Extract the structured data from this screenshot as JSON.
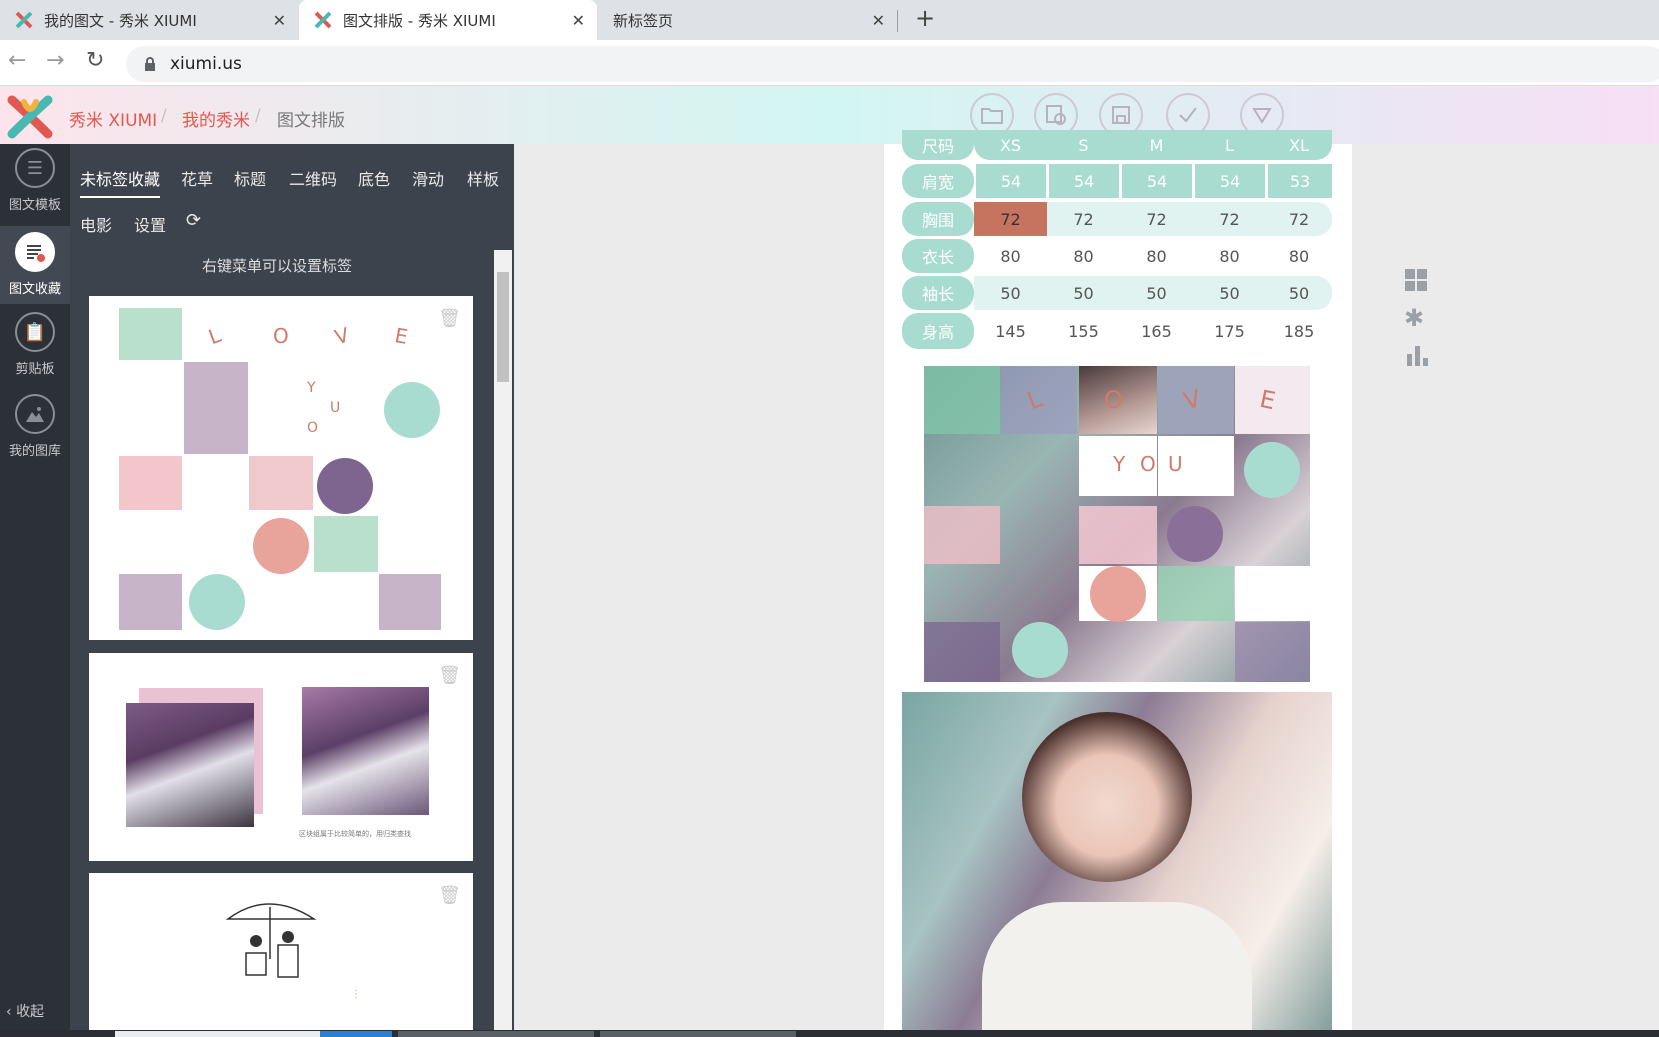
{
  "browser": {
    "tabs": [
      {
        "title": "我的图文 - 秀米 XIUMI"
      },
      {
        "title": "图文排版 - 秀米 XIUMI"
      },
      {
        "title": "新标签页"
      }
    ],
    "url": "xiumi.us"
  },
  "header": {
    "brand": "秀米 XIUMI",
    "breadcrumb": [
      "我的秀米",
      "图文排版"
    ],
    "separator": "/"
  },
  "leftnav": {
    "items": [
      {
        "label": "图文模板",
        "icon": "list-icon"
      },
      {
        "label": "图文收藏",
        "icon": "favorite-icon"
      },
      {
        "label": "剪贴板",
        "icon": "clipboard-icon"
      },
      {
        "label": "我的图库",
        "icon": "gallery-icon"
      }
    ],
    "collapse_label": "收起"
  },
  "panel": {
    "tabs_row1": [
      "未标签收藏",
      "花草",
      "标题",
      "二维码",
      "底色",
      "滑动",
      "样板"
    ],
    "tabs_row2": [
      "电影",
      "设置"
    ],
    "hint": "右键菜单可以设置标签",
    "card1_letters": [
      "L",
      "O",
      "V",
      "E",
      "Y",
      "U",
      "O"
    ],
    "card2_caption": "区块组属于比较简单的，用归类查找"
  },
  "size_table": {
    "header": [
      "尺码",
      "XS",
      "S",
      "M",
      "L",
      "XL"
    ],
    "rows": [
      {
        "label": "肩宽",
        "values": [
          "54",
          "54",
          "54",
          "54",
          "53"
        ]
      },
      {
        "label": "胸围",
        "values": [
          "72",
          "72",
          "72",
          "72",
          "72"
        ]
      },
      {
        "label": "衣长",
        "values": [
          "80",
          "80",
          "80",
          "80",
          "80"
        ]
      },
      {
        "label": "袖长",
        "values": [
          "50",
          "50",
          "50",
          "50",
          "50"
        ]
      },
      {
        "label": "身高",
        "values": [
          "145",
          "155",
          "165",
          "175",
          "185"
        ]
      }
    ]
  },
  "collage": {
    "letters": [
      "L",
      "O",
      "V",
      "E",
      "Y",
      "O",
      "U"
    ]
  },
  "colors": {
    "mint": "#a8dcd1",
    "mauve": "#c7b4c9",
    "pink": "#f2c6cb",
    "purple": "#7d6590",
    "coral": "#e8a39a",
    "brand_red": "#e0584f",
    "highlight": "#c6735f"
  }
}
